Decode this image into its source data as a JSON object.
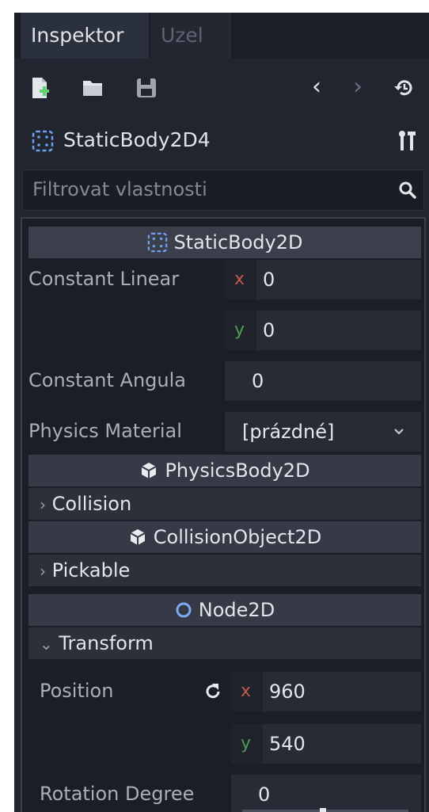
{
  "tabs": {
    "inspector": "Inspektor",
    "node": "Uzel"
  },
  "toolbar": {
    "icons": [
      "new-resource-icon",
      "open-folder-icon",
      "save-icon",
      "back-icon",
      "forward-icon",
      "history-icon"
    ]
  },
  "node": {
    "name": "StaticBody2D4"
  },
  "filter": {
    "placeholder": "Filtrovat vlastnosti"
  },
  "sections": {
    "static_body": "StaticBody2D",
    "physics_body": "PhysicsBody2D",
    "collision_object": "CollisionObject2D",
    "node2d": "Node2D"
  },
  "groups": {
    "collision": "Collision",
    "pickable": "Pickable",
    "transform": "Transform"
  },
  "properties": {
    "constant_linear": {
      "label": "Constant Linear",
      "x": "0",
      "y": "0"
    },
    "constant_angular": {
      "label": "Constant Angula",
      "value": "0"
    },
    "physics_material": {
      "label": "Physics Material",
      "value": "[prázdné]"
    },
    "position": {
      "label": "Position",
      "x": "960",
      "y": "540"
    },
    "rotation": {
      "label": "Rotation Degree",
      "value": "0"
    }
  },
  "axis_labels": {
    "x": "x",
    "y": "y"
  },
  "colors": {
    "accent_blue": "#6fa0f0",
    "axis_x": "#c45a4a",
    "axis_y": "#4f9a55"
  }
}
